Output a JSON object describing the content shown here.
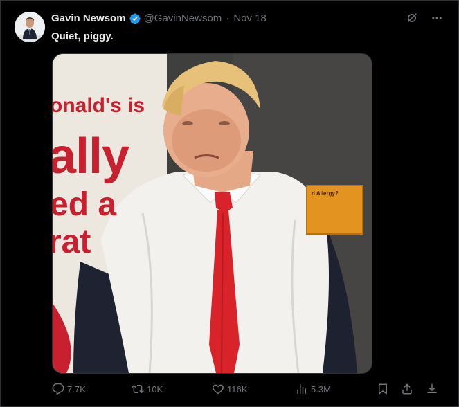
{
  "tweet": {
    "author_name": "Gavin Newsom",
    "handle": "@GavinNewsom",
    "separator": "·",
    "date": "Nov 18",
    "text": "Quiet, piggy.",
    "verified": true
  },
  "media": {
    "sign_lines": [
      "onald's is",
      "ally",
      "ed a",
      "rat"
    ],
    "allergy_sign_title": "d Allergy?"
  },
  "actions": {
    "replies": "7.7K",
    "reposts": "10K",
    "likes": "116K",
    "views": "5.3M"
  },
  "icons": {
    "verified": "verified-badge-icon",
    "grok": "grok-icon",
    "more": "more-icon",
    "reply": "reply-icon",
    "repost": "repost-icon",
    "like": "heart-icon",
    "views": "views-icon",
    "bookmark": "bookmark-icon",
    "share": "share-icon",
    "download": "download-icon"
  },
  "colors": {
    "background": "#000000",
    "text_primary": "#e7e9ea",
    "text_secondary": "#71767b",
    "verified_blue": "#1d9bf0",
    "sign_red": "#c8202f",
    "tie_red": "#d8232a"
  }
}
